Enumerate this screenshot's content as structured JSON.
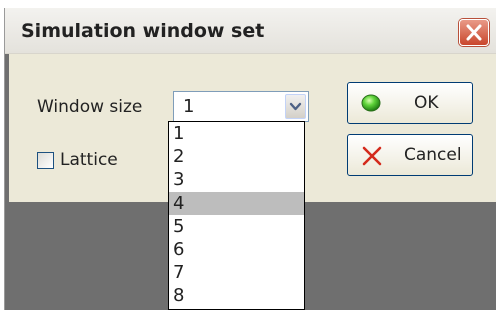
{
  "dialog": {
    "title": "Simulation window set"
  },
  "window_size": {
    "label": "Window size",
    "value": "1"
  },
  "lattice": {
    "label": "Lattice",
    "checked": false
  },
  "buttons": {
    "ok": "OK",
    "cancel": "Cancel"
  },
  "dropdown": {
    "options": [
      "1",
      "2",
      "3",
      "4",
      "5",
      "6",
      "7",
      "8"
    ],
    "highlighted": "4"
  },
  "icons": {
    "close": "close-icon",
    "dropdown_arrow": "chevron-down-icon",
    "ok": "green-orb-icon",
    "cancel": "red-x-icon"
  },
  "colors": {
    "ok_icon": "#36c02a",
    "cancel_icon": "#d42a1c",
    "close_button": "#c9462c",
    "highlight": "#bdbdbd"
  }
}
